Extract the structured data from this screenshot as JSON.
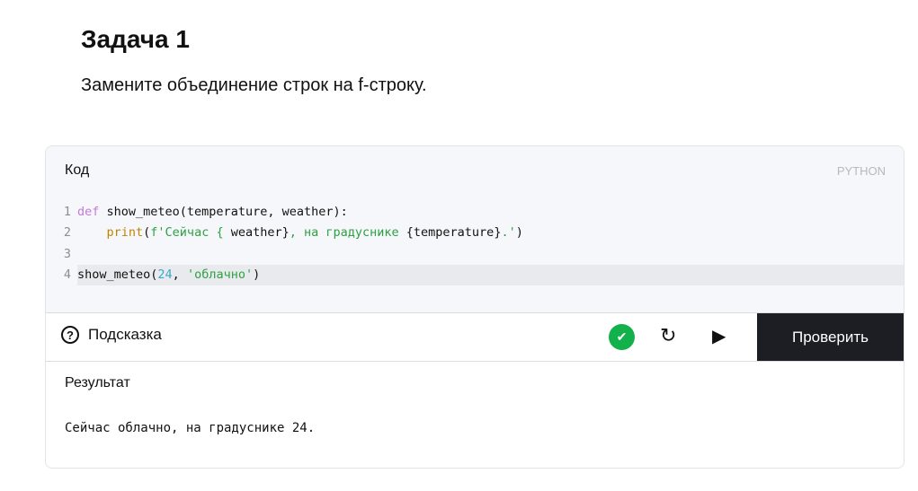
{
  "title": "Задача 1",
  "description": "Замените объединение строк на f-строку.",
  "editor": {
    "header": "Код",
    "language": "PYTHON",
    "lines": [
      {
        "n": "1",
        "parts": [
          [
            "kw",
            "def"
          ],
          [
            "",
            "  show_meteo(temperature, weather):"
          ]
        ]
      },
      {
        "n": "2",
        "parts": [
          [
            "",
            "    "
          ],
          [
            "fn",
            "print"
          ],
          [
            "",
            "("
          ],
          [
            "str",
            "f'Сейчас { "
          ],
          [
            "",
            "weather}"
          ],
          [
            "str",
            ", на градуснике "
          ],
          [
            "",
            "{temperature}"
          ],
          [
            "str",
            ".'"
          ],
          [
            "",
            ")"
          ]
        ]
      },
      {
        "n": "3",
        "parts": []
      },
      {
        "n": "4",
        "parts": [
          [
            "",
            "show_meteo("
          ],
          [
            "num",
            "24"
          ],
          [
            "",
            ", "
          ],
          [
            "str",
            "'облачно'"
          ],
          [
            "",
            ")"
          ]
        ]
      }
    ]
  },
  "toolbar": {
    "hint": "Подсказка",
    "check": "Проверить",
    "status_icon": "check-circle",
    "reset_icon": "reset",
    "run_icon": "play"
  },
  "result": {
    "header": "Результат",
    "output": "Сейчас облачно, на градуснике 24."
  }
}
